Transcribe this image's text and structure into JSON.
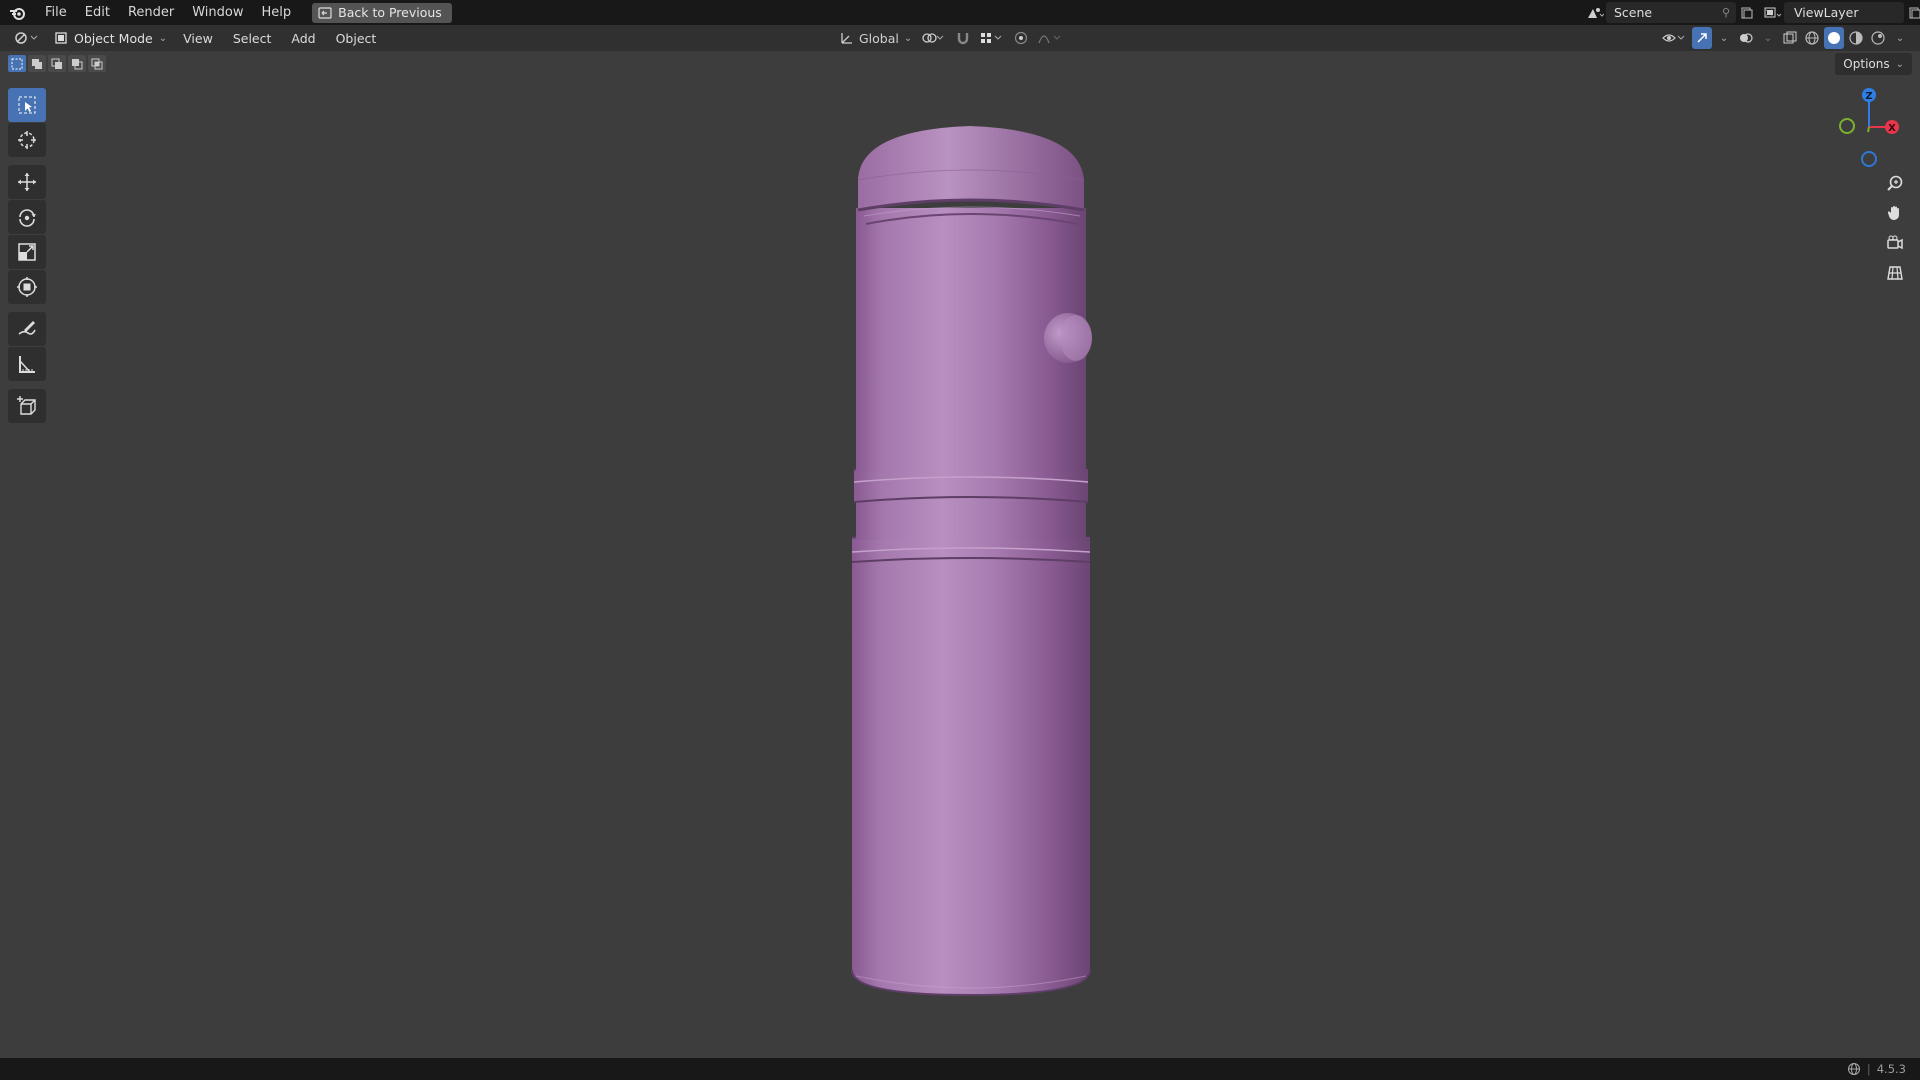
{
  "topbar": {
    "menus": [
      "File",
      "Edit",
      "Render",
      "Window",
      "Help"
    ],
    "back_label": "Back to Previous",
    "scene_name": "Scene",
    "view_layer_name": "ViewLayer"
  },
  "header": {
    "mode_label": "Object Mode",
    "menus": [
      "View",
      "Select",
      "Add",
      "Object"
    ],
    "orientation_label": "Global"
  },
  "options_label": "Options",
  "gizmo": {
    "z_label": "Z",
    "x_label": "X",
    "z_color": "#2f7ee6",
    "x_color": "#e8364d",
    "y_color": "#7ab22d"
  },
  "tools": [
    "select-box",
    "cursor",
    "move",
    "rotate",
    "scale",
    "transform",
    "annotate",
    "measure",
    "add-cube"
  ],
  "object": {
    "color": "#a77bb0",
    "shading": "solid"
  },
  "status": {
    "version": "4.5.3"
  }
}
